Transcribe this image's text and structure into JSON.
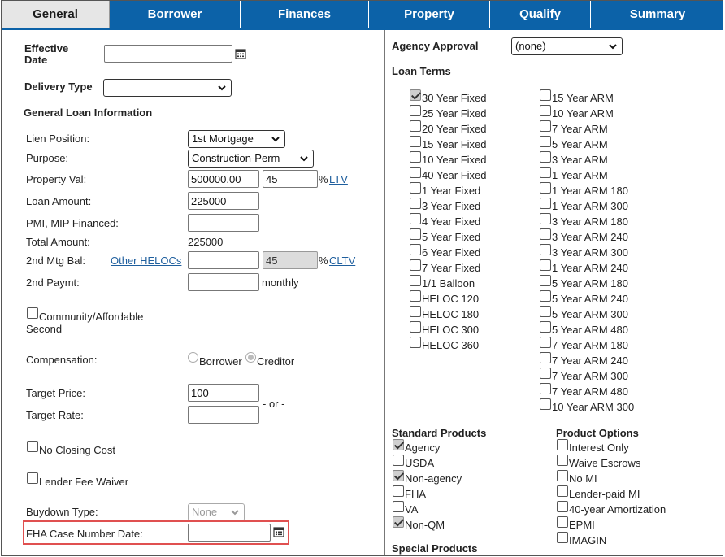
{
  "tabs": [
    "General",
    "Borrower",
    "Finances",
    "Property",
    "Qualify",
    "Summary"
  ],
  "left": {
    "effective_date_label": "Effective\nDate",
    "effective_date_value": "",
    "delivery_type_label": "Delivery Type",
    "delivery_type_value": "",
    "general_loan_info_heading": "General Loan Information",
    "lien_position_label": "Lien Position:",
    "lien_position_value": "1st Mortgage",
    "purpose_label": "Purpose:",
    "purpose_value": "Construction-Perm",
    "property_val_label": "Property Val:",
    "property_val_value": "500000.00",
    "ltv_value": "45",
    "percent_sign": "%",
    "ltv_link": "LTV",
    "loan_amount_label": "Loan Amount:",
    "loan_amount_value": "225000",
    "pmi_label": "PMI, MIP Financed:",
    "pmi_value": "",
    "total_amount_label": "Total Amount:",
    "total_amount_value": "225000",
    "second_mtg_label": "2nd Mtg Bal:",
    "other_helocs_link": "Other HELOCs",
    "second_mtg_value": "",
    "cltv_value": "45",
    "cltv_link": "CLTV",
    "second_paymt_label": "2nd Paymt:",
    "second_paymt_value": "",
    "monthly_label": "monthly",
    "community_label": "Community/Affordable\nSecond",
    "community_checked": false,
    "compensation_label": "Compensation:",
    "comp_borrower": "Borrower",
    "comp_creditor": "Creditor",
    "target_price_label": "Target Price:",
    "target_price_value": "100",
    "or_label": "- or -",
    "target_rate_label": "Target Rate:",
    "target_rate_value": "",
    "no_closing_cost_label": "No Closing Cost",
    "lender_fee_waiver_label": "Lender Fee Waiver",
    "buydown_type_label": "Buydown Type:",
    "buydown_type_value": "None",
    "fha_case_label": "FHA Case Number Date:",
    "fha_case_value": ""
  },
  "right": {
    "agency_approval_label": "Agency Approval",
    "agency_approval_value": "(none)",
    "loan_terms_heading": "Loan Terms",
    "loan_terms_col1": [
      {
        "label": "30 Year Fixed",
        "checked": true
      },
      {
        "label": "25 Year Fixed",
        "checked": false
      },
      {
        "label": "20 Year Fixed",
        "checked": false
      },
      {
        "label": "15 Year Fixed",
        "checked": false
      },
      {
        "label": "10 Year Fixed",
        "checked": false
      },
      {
        "label": "40 Year Fixed",
        "checked": false
      },
      {
        "label": "1 Year Fixed",
        "checked": false
      },
      {
        "label": "3 Year Fixed",
        "checked": false
      },
      {
        "label": "4 Year Fixed",
        "checked": false
      },
      {
        "label": "5 Year Fixed",
        "checked": false
      },
      {
        "label": "6 Year Fixed",
        "checked": false
      },
      {
        "label": "7 Year Fixed",
        "checked": false
      },
      {
        "label": "1/1 Balloon",
        "checked": false
      },
      {
        "label": "HELOC 120",
        "checked": false
      },
      {
        "label": "HELOC 180",
        "checked": false
      },
      {
        "label": "HELOC 300",
        "checked": false
      },
      {
        "label": "HELOC 360",
        "checked": false
      }
    ],
    "loan_terms_col2": [
      {
        "label": "15 Year ARM",
        "checked": false
      },
      {
        "label": "10 Year ARM",
        "checked": false
      },
      {
        "label": "7 Year ARM",
        "checked": false
      },
      {
        "label": "5 Year ARM",
        "checked": false
      },
      {
        "label": "3 Year ARM",
        "checked": false
      },
      {
        "label": "1 Year ARM",
        "checked": false
      },
      {
        "label": "1 Year ARM 180",
        "checked": false
      },
      {
        "label": "1 Year ARM 300",
        "checked": false
      },
      {
        "label": "3 Year ARM 180",
        "checked": false
      },
      {
        "label": "3 Year ARM 240",
        "checked": false
      },
      {
        "label": "3 Year ARM 300",
        "checked": false
      },
      {
        "label": "1 Year ARM 240",
        "checked": false
      },
      {
        "label": "5 Year ARM 180",
        "checked": false
      },
      {
        "label": "5 Year ARM 240",
        "checked": false
      },
      {
        "label": "5 Year ARM 300",
        "checked": false
      },
      {
        "label": "5 Year ARM 480",
        "checked": false
      },
      {
        "label": "7 Year ARM 180",
        "checked": false
      },
      {
        "label": "7 Year ARM 240",
        "checked": false
      },
      {
        "label": "7 Year ARM 300",
        "checked": false
      },
      {
        "label": "7 Year ARM 480",
        "checked": false
      },
      {
        "label": "10 Year ARM 300",
        "checked": false
      }
    ],
    "standard_products_heading": "Standard Products",
    "standard_products": [
      {
        "label": "Agency",
        "checked": true
      },
      {
        "label": "USDA",
        "checked": false
      },
      {
        "label": "Non-agency",
        "checked": true
      },
      {
        "label": "FHA",
        "checked": false
      },
      {
        "label": "VA",
        "checked": false
      },
      {
        "label": "Non-QM",
        "checked": true
      }
    ],
    "product_options_heading": "Product Options",
    "product_options": [
      {
        "label": "Interest Only",
        "checked": false
      },
      {
        "label": "Waive Escrows",
        "checked": false
      },
      {
        "label": "No MI",
        "checked": false
      },
      {
        "label": "Lender-paid MI",
        "checked": false
      },
      {
        "label": "40-year Amortization",
        "checked": false
      },
      {
        "label": "EPMI",
        "checked": false
      },
      {
        "label": "IMAGIN",
        "checked": false
      }
    ],
    "special_products_heading": "Special Products"
  },
  "colors": {
    "tab_blue": "#0c62a8",
    "link": "#1f5f9e",
    "highlight": "#e05050"
  }
}
